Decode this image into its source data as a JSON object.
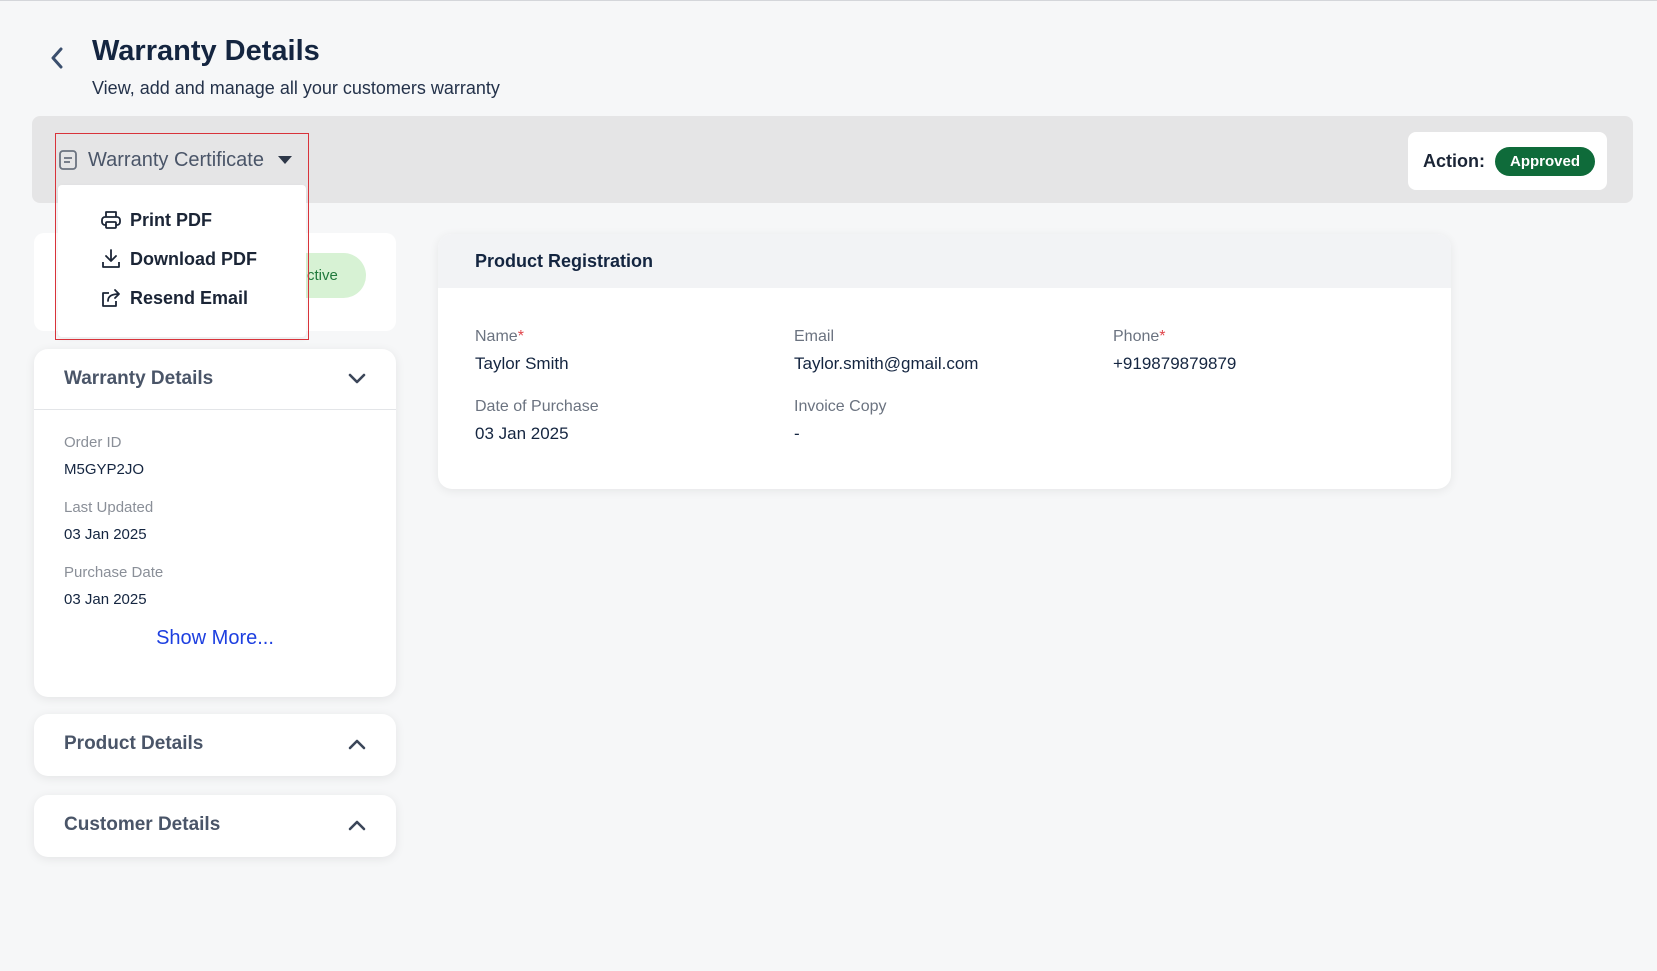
{
  "header": {
    "title": "Warranty Details",
    "subtitle": "View, add and manage all your customers warranty"
  },
  "toolbar": {
    "certificate_label": "Warranty Certificate",
    "action_label": "Action:",
    "action_status": "Approved"
  },
  "dropdown": {
    "items": [
      {
        "label": "Print PDF",
        "icon": "printer-icon"
      },
      {
        "label": "Download PDF",
        "icon": "download-icon"
      },
      {
        "label": "Resend Email",
        "icon": "share-icon"
      }
    ]
  },
  "status": {
    "partial_label": "ctive"
  },
  "warranty_details": {
    "title": "Warranty Details",
    "fields": [
      {
        "label": "Order ID",
        "value": "M5GYP2JO"
      },
      {
        "label": "Last Updated",
        "value": "03 Jan 2025"
      },
      {
        "label": "Purchase Date",
        "value": "03 Jan 2025"
      }
    ],
    "show_more": "Show More..."
  },
  "product_details": {
    "title": "Product Details"
  },
  "customer_details": {
    "title": "Customer Details"
  },
  "product_registration": {
    "title": "Product Registration",
    "fields": [
      {
        "label": "Name",
        "required": "*",
        "value": "Taylor Smith"
      },
      {
        "label": "Email",
        "required": "",
        "value": "Taylor.smith@gmail.com"
      },
      {
        "label": "Phone",
        "required": "*",
        "value": "+919879879879"
      },
      {
        "label": "Date of Purchase",
        "required": "",
        "value": "03 Jan 2025"
      },
      {
        "label": "Invoice Copy",
        "required": "",
        "value": "-"
      }
    ]
  },
  "colors": {
    "approved": "#0f6b3a",
    "highlight": "#d8333a",
    "link": "#1d3fe0",
    "required": "#e0454b"
  }
}
